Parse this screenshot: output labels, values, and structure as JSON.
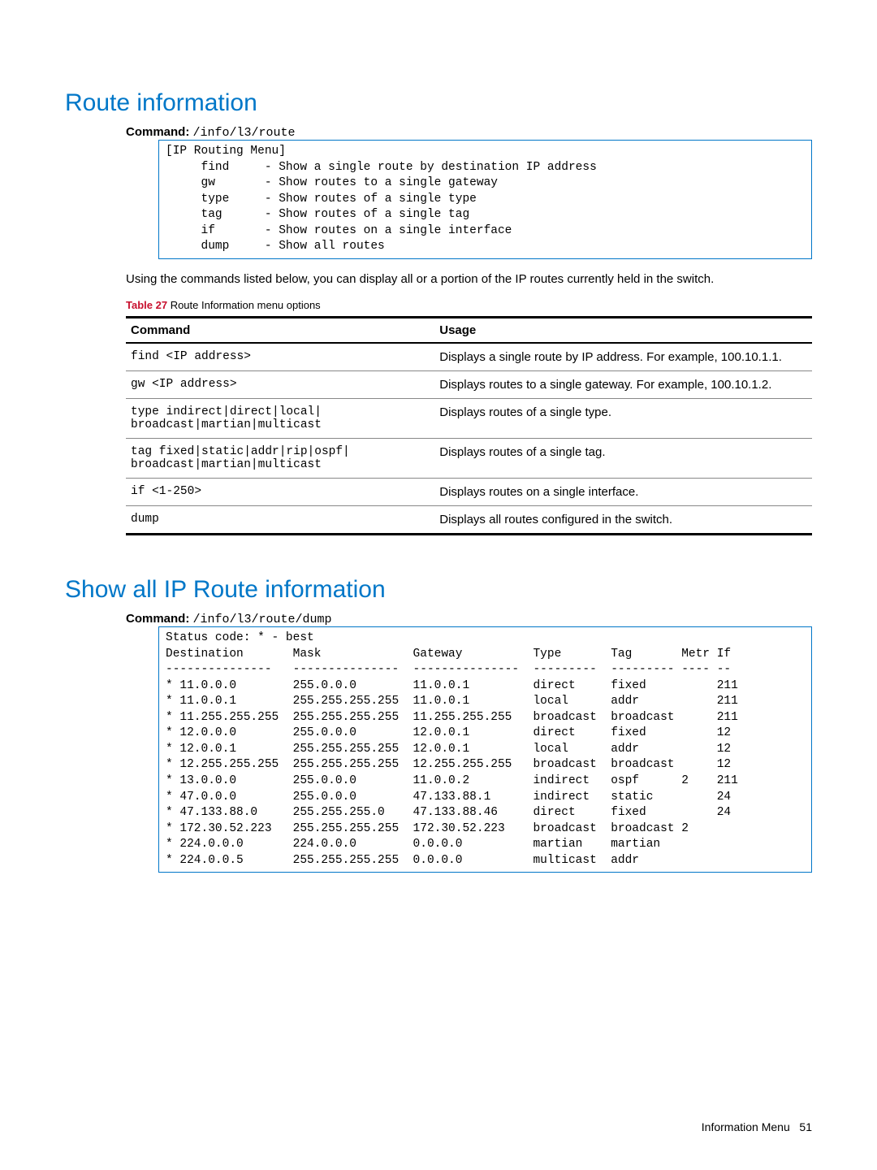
{
  "section1": {
    "heading": "Route information",
    "command_label": "Command:",
    "command_value": "/info/l3/route",
    "terminal": "[IP Routing Menu]\n     find     - Show a single route by destination IP address\n     gw       - Show routes to a single gateway\n     type     - Show routes of a single type\n     tag      - Show routes of a single tag\n     if       - Show routes on a single interface\n     dump     - Show all routes",
    "paragraph": "Using the commands listed below, you can display all or a portion of the IP routes currently held in the switch.",
    "table_label": "Table 27",
    "table_caption": "Route Information menu options",
    "th_command": "Command",
    "th_usage": "Usage",
    "rows": [
      {
        "cmd": "find <IP address>",
        "usage": "Displays a single route by IP address. For example, 100.10.1.1."
      },
      {
        "cmd": "gw <IP address>",
        "usage": "Displays routes to a single gateway. For example, 100.10.1.2."
      },
      {
        "cmd": "type indirect|direct|local|\nbroadcast|martian|multicast",
        "usage": "Displays routes of a single type."
      },
      {
        "cmd": "tag fixed|static|addr|rip|ospf|\nbroadcast|martian|multicast",
        "usage": "Displays routes of a single tag."
      },
      {
        "cmd": "if <1-250>",
        "usage": "Displays routes on a single interface."
      },
      {
        "cmd": "dump",
        "usage": "Displays all routes configured in the switch."
      }
    ]
  },
  "section2": {
    "heading": "Show all IP Route information",
    "command_label": "Command:",
    "command_value": "/info/l3/route/dump",
    "terminal": "Status code: * - best\nDestination       Mask             Gateway          Type       Tag       Metr If\n---------------   ---------------  ---------------  ---------  --------- ---- --\n* 11.0.0.0        255.0.0.0        11.0.0.1         direct     fixed          211\n* 11.0.0.1        255.255.255.255  11.0.0.1         local      addr           211\n* 11.255.255.255  255.255.255.255  11.255.255.255   broadcast  broadcast      211\n* 12.0.0.0        255.0.0.0        12.0.0.1         direct     fixed          12\n* 12.0.0.1        255.255.255.255  12.0.0.1         local      addr           12\n* 12.255.255.255  255.255.255.255  12.255.255.255   broadcast  broadcast      12\n* 13.0.0.0        255.0.0.0        11.0.0.2         indirect   ospf      2    211\n* 47.0.0.0        255.0.0.0        47.133.88.1      indirect   static         24\n* 47.133.88.0     255.255.255.0    47.133.88.46     direct     fixed          24\n* 172.30.52.223   255.255.255.255  172.30.52.223    broadcast  broadcast 2\n* 224.0.0.0       224.0.0.0        0.0.0.0          martian    martian\n* 224.0.0.5       255.255.255.255  0.0.0.0          multicast  addr"
  },
  "footer": {
    "section": "Information Menu",
    "page": "51"
  }
}
